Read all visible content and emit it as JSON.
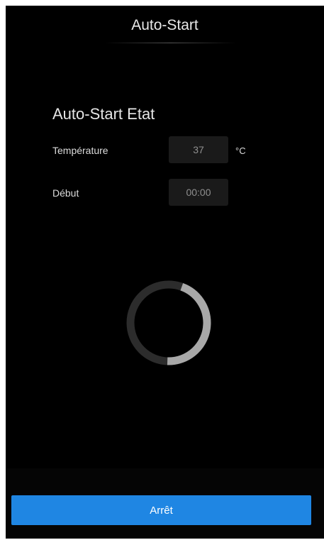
{
  "header": {
    "title": "Auto-Start"
  },
  "status": {
    "section_title": "Auto-Start Etat",
    "temperature": {
      "label": "Température",
      "value": "37",
      "unit": "°C"
    },
    "start": {
      "label": "Début",
      "value": "00:00"
    }
  },
  "progress": {
    "fraction": 0.45
  },
  "footer": {
    "stop_label": "Arrêt"
  },
  "colors": {
    "background": "#000000",
    "accent": "#1f86e3",
    "ring_active": "#a8a8a8",
    "ring_track": "#2c2c2c"
  }
}
